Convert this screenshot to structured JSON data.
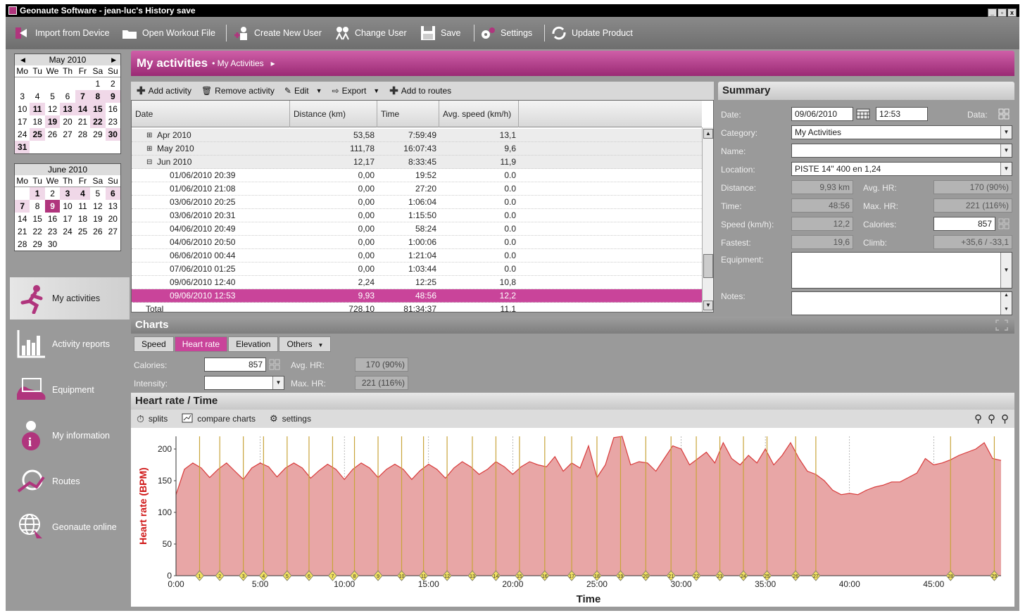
{
  "window": {
    "title": "Geonaute Software - jean-luc's History save",
    "controls": [
      "_",
      "▫",
      "x"
    ]
  },
  "toolbar": {
    "import": "Import from Device",
    "open": "Open Workout File",
    "create_user": "Create New User",
    "change_user": "Change User",
    "save": "Save",
    "settings": "Settings",
    "update": "Update Product"
  },
  "cal_may": {
    "title": "May 2010",
    "weekdays": [
      "Mo",
      "Tu",
      "We",
      "Th",
      "Fr",
      "Sa",
      "Su"
    ],
    "days": [
      "",
      "",
      "",
      "",
      "",
      "1",
      "2",
      "3",
      "4",
      "5",
      "6",
      "7",
      "8",
      "9",
      "10",
      "11",
      "12",
      "13",
      "14",
      "15",
      "16",
      "17",
      "18",
      "19",
      "20",
      "21",
      "22",
      "23",
      "24",
      "25",
      "26",
      "27",
      "28",
      "29",
      "30",
      "31"
    ],
    "active": [
      "7",
      "8",
      "9",
      "11",
      "13",
      "14",
      "15",
      "19",
      "22",
      "25",
      "30",
      "31"
    ]
  },
  "cal_jun": {
    "title": "June 2010",
    "weekdays": [
      "Mo",
      "Tu",
      "We",
      "Th",
      "Fr",
      "Sa",
      "Su"
    ],
    "days": [
      "",
      "1",
      "2",
      "3",
      "4",
      "5",
      "6",
      "7",
      "8",
      "9",
      "10",
      "11",
      "12",
      "13",
      "14",
      "15",
      "16",
      "17",
      "18",
      "19",
      "20",
      "21",
      "22",
      "23",
      "24",
      "25",
      "26",
      "27",
      "28",
      "29",
      "30"
    ],
    "active": [
      "1",
      "3",
      "4",
      "6",
      "7"
    ],
    "selected": "9"
  },
  "nav": {
    "my_activities": "My activities",
    "reports": "Activity reports",
    "equipment": "Equipment",
    "info": "My information",
    "routes": "Routes",
    "online": "Geonaute online"
  },
  "main": {
    "title": "My activities",
    "crumb": "My Activities"
  },
  "acts": {
    "add": "Add activity",
    "remove": "Remove activity",
    "edit": "Edit",
    "export": "Export",
    "routes": "Add to routes"
  },
  "table": {
    "headers": [
      "Date",
      "Distance (km)",
      "Time",
      "Avg. speed (km/h)"
    ],
    "rows": [
      {
        "kind": "grp",
        "exp": "⊞",
        "date": "Apr 2010",
        "dist": "53,58",
        "time": "7:59:49",
        "speed": "13,1"
      },
      {
        "kind": "grp",
        "exp": "⊞",
        "date": "May 2010",
        "dist": "111,78",
        "time": "16:07:43",
        "speed": "9,6"
      },
      {
        "kind": "grp",
        "exp": "⊟",
        "date": "Jun 2010",
        "dist": "12,17",
        "time": "8:33:45",
        "speed": "11,9"
      },
      {
        "kind": "row",
        "date": "01/06/2010 20:39",
        "dist": "0,00",
        "time": "19:52",
        "speed": "0.0"
      },
      {
        "kind": "row",
        "date": "01/06/2010 21:08",
        "dist": "0,00",
        "time": "27:20",
        "speed": "0.0"
      },
      {
        "kind": "row",
        "date": "03/06/2010 20:25",
        "dist": "0,00",
        "time": "1:06:04",
        "speed": "0.0"
      },
      {
        "kind": "row",
        "date": "03/06/2010 20:31",
        "dist": "0,00",
        "time": "1:15:50",
        "speed": "0.0"
      },
      {
        "kind": "row",
        "date": "04/06/2010 20:49",
        "dist": "0,00",
        "time": "58:24",
        "speed": "0.0"
      },
      {
        "kind": "row",
        "date": "04/06/2010 20:50",
        "dist": "0,00",
        "time": "1:00:06",
        "speed": "0.0"
      },
      {
        "kind": "row",
        "date": "06/06/2010 00:44",
        "dist": "0,00",
        "time": "1:21:04",
        "speed": "0.0"
      },
      {
        "kind": "row",
        "date": "07/06/2010 01:25",
        "dist": "0,00",
        "time": "1:03:44",
        "speed": "0.0"
      },
      {
        "kind": "row",
        "date": "09/06/2010 12:40",
        "dist": "2,24",
        "time": "12:25",
        "speed": "10,8"
      },
      {
        "kind": "sel",
        "date": "09/06/2010 12:53",
        "dist": "9,93",
        "time": "48:56",
        "speed": "12,2"
      },
      {
        "kind": "tot",
        "date": "Total",
        "dist": "728,10",
        "time": "81:34:37",
        "speed": "11,1"
      }
    ]
  },
  "summary": {
    "title": "Summary",
    "date_label": "Date:",
    "date": "09/06/2010",
    "time": "12:53",
    "data_label": "Data:",
    "category_label": "Category:",
    "category": "My Activities",
    "name_label": "Name:",
    "name": "",
    "location_label": "Location:",
    "location": "PISTE 14\" 400  en 1,24",
    "distance_label": "Distance:",
    "distance": "9,93 km",
    "avghr_label": "Avg. HR:",
    "avghr": "170 (90%)",
    "time_label": "Time:",
    "time_val": "48:56",
    "maxhr_label": "Max. HR:",
    "maxhr": "221 (116%)",
    "speed_label": "Speed (km/h):",
    "speed": "12,2",
    "cal_label": "Calories:",
    "calories": "857",
    "fastest_label": "Fastest:",
    "fastest": "19,6",
    "climb_label": "Climb:",
    "climb": "+35,6 / -33,1",
    "equip_label": "Equipment:",
    "notes_label": "Notes:"
  },
  "charts": {
    "title": "Charts",
    "tabs": [
      "Speed",
      "Heart rate",
      "Elevation",
      "Others"
    ],
    "active_tab": "Heart rate",
    "calories_label": "Calories:",
    "calories": "857",
    "avghr_label": "Avg. HR:",
    "avghr": "170 (90%)",
    "intensity_label": "Intensity:",
    "maxhr_label": "Max. HR:",
    "maxhr": "221 (116%)"
  },
  "hr": {
    "title": "Heart rate / Time",
    "splits": "splits",
    "compare": "compare charts",
    "settings": "settings"
  },
  "chart_data": {
    "type": "area",
    "title": "",
    "xlabel": "Time",
    "ylabel": "Heart rate (BPM)",
    "xlim": [
      0,
      49
    ],
    "ylim": [
      0,
      220
    ],
    "xticks": [
      "0:00",
      "5:00",
      "10:00",
      "15:00",
      "20:00",
      "25:00",
      "30:00",
      "35:00",
      "40:00",
      "45:00"
    ],
    "yticks": [
      0,
      50,
      100,
      150,
      200
    ],
    "x": [
      0,
      0.5,
      1,
      1.5,
      2,
      2.5,
      3,
      3.5,
      4,
      4.5,
      5,
      5.5,
      6,
      6.5,
      7,
      7.5,
      8,
      8.5,
      9,
      9.5,
      10,
      10.5,
      11,
      11.5,
      12,
      12.5,
      13,
      13.5,
      14,
      14.5,
      15,
      15.5,
      16,
      16.5,
      17,
      17.5,
      18,
      18.5,
      19,
      19.5,
      20,
      20.5,
      21,
      21.5,
      22,
      22.5,
      23,
      23.5,
      24,
      24.5,
      25,
      25.5,
      26,
      26.5,
      27,
      27.5,
      28,
      28.5,
      29,
      29.5,
      30,
      30.5,
      31,
      31.5,
      32,
      32.5,
      33,
      33.5,
      34,
      34.5,
      35,
      35.5,
      36,
      36.5,
      37,
      37.5,
      38,
      38.5,
      39,
      39.5,
      40,
      40.5,
      41,
      41.5,
      42,
      42.5,
      43,
      43.5,
      44,
      44.5,
      45,
      45.5,
      46,
      46.5,
      47,
      47.5,
      48,
      48.5,
      49
    ],
    "y": [
      128,
      168,
      178,
      170,
      155,
      168,
      178,
      165,
      152,
      170,
      178,
      172,
      156,
      170,
      178,
      170,
      154,
      166,
      176,
      168,
      152,
      168,
      178,
      170,
      155,
      168,
      176,
      168,
      152,
      166,
      176,
      168,
      154,
      170,
      180,
      172,
      160,
      168,
      180,
      172,
      160,
      172,
      180,
      175,
      172,
      188,
      165,
      178,
      170,
      205,
      155,
      175,
      218,
      220,
      175,
      180,
      178,
      165,
      185,
      205,
      200,
      175,
      185,
      195,
      178,
      210,
      185,
      175,
      190,
      178,
      200,
      175,
      190,
      210,
      185,
      165,
      160,
      150,
      135,
      128,
      130,
      128,
      135,
      140,
      143,
      148,
      148,
      155,
      162,
      185,
      175,
      178,
      183,
      190,
      195,
      200,
      210,
      185,
      182
    ],
    "splits": [
      1,
      2,
      3,
      4,
      5,
      6,
      7,
      8,
      9,
      10,
      11,
      12,
      13,
      14,
      15,
      16,
      17,
      18,
      19,
      20,
      21,
      22,
      23,
      24,
      25,
      26,
      27,
      28,
      29
    ],
    "split_times": [
      1.4,
      2.6,
      4.0,
      5.2,
      6.6,
      7.9,
      9.3,
      10.6,
      12.0,
      13.4,
      14.7,
      16.1,
      17.6,
      19.0,
      20.4,
      21.9,
      23.5,
      25.0,
      26.4,
      27.9,
      29.4,
      30.9,
      32.3,
      33.7,
      35.1,
      36.8,
      38.0,
      46.0,
      48.6
    ],
    "colors": {
      "fill": "#e8a6a6",
      "line": "#d83a3a",
      "split": "#c8a43a"
    }
  }
}
